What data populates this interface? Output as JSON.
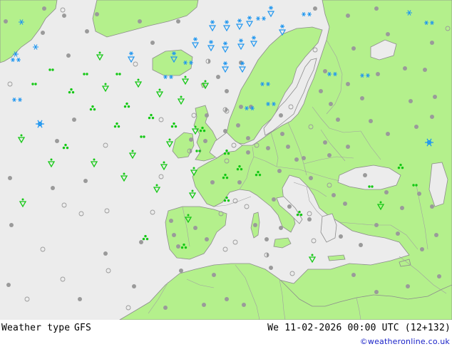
{
  "footer": {
    "title": "Weather type",
    "model": "GFS",
    "datetime": "We 11-02-2026 00:00 UTC (12+132)",
    "credit": "©weatheronline.co.uk"
  },
  "colors": {
    "sea": "#ececec",
    "land": "#b4f08c",
    "border": "#a0a0a0",
    "coast": "#8c8c8c",
    "dry_dot": "#9a9a9a",
    "rain": "#14c814",
    "snow": "#1e96f0"
  },
  "symbol_legend": {
    "dot": "dry / fair",
    "ring": "cloudy",
    "half": "overcast",
    "rain-arrow": "rain shower",
    "drizzle": "drizzle / rain",
    "cluster": "heavy rain / thunder",
    "snow": "snow",
    "snow-arrow": "snow shower",
    "snow-pair": "snow / heavy snow"
  }
}
